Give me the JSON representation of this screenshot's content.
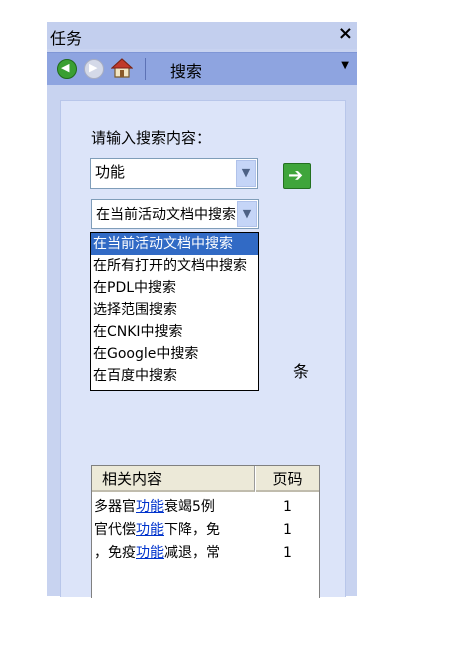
{
  "pane": {
    "title": "任务",
    "close_glyph": "×"
  },
  "toolbar": {
    "label": "搜索",
    "dropdown_glyph": "▼"
  },
  "search": {
    "prompt": "请输入搜索内容：",
    "query": "功能",
    "scope_selected": "在当前活动文档中搜索",
    "scope_options": [
      "在当前活动文档中搜索",
      "在所有打开的文档中搜索",
      "在PDL中搜索",
      "选择范围搜索",
      "在CNKI中搜索",
      "在Google中搜索",
      "在百度中搜索"
    ],
    "count_unit": "条"
  },
  "results": {
    "headers": {
      "content": "相关内容",
      "page": "页码"
    },
    "rows": [
      {
        "before": "多器官",
        "hit": "功能",
        "after": "衰竭5例",
        "page": "1"
      },
      {
        "before": "官代偿",
        "hit": "功能",
        "after": "下降，免",
        "page": "1"
      },
      {
        "before": "，免疫",
        "hit": "功能",
        "after": "减退，常",
        "page": "1"
      }
    ]
  }
}
